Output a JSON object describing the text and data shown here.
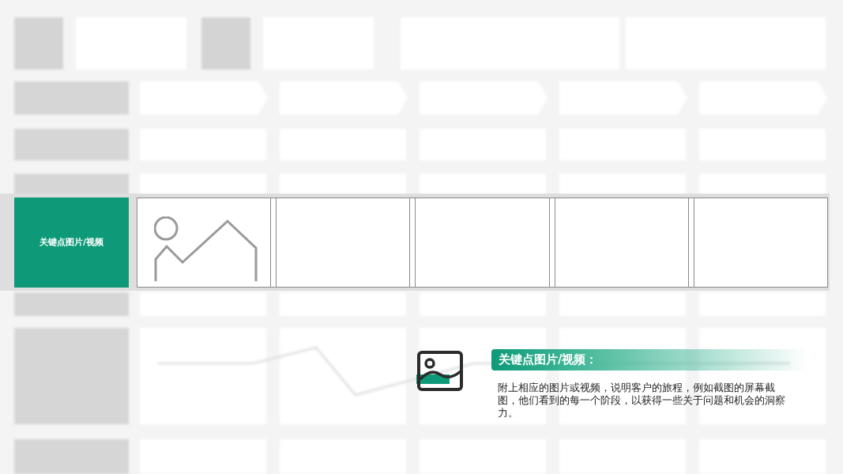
{
  "focus_row": {
    "label": "关键点图片/视频",
    "cells": [
      {
        "kind": "picture-placeholder"
      },
      {
        "kind": "empty"
      },
      {
        "kind": "empty"
      },
      {
        "kind": "empty"
      },
      {
        "kind": "empty"
      }
    ]
  },
  "callout": {
    "title": "关键点图片/视频：",
    "text": "附上相应的图片或视频，说明客户的旅程，例如截图的屏幕截图，他们看到的每一个阶段，以获得一些关于问题和机会的洞察力。"
  }
}
